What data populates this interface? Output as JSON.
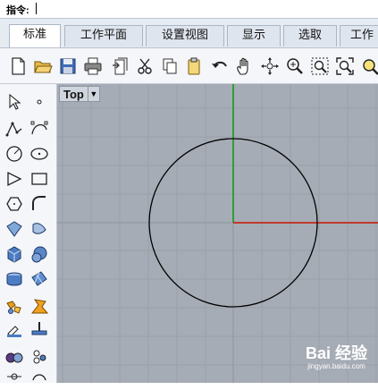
{
  "command": {
    "label": "指令:"
  },
  "tabs": [
    {
      "label": "标准",
      "active": true
    },
    {
      "label": "工作平面",
      "active": false
    },
    {
      "label": "设置视图",
      "active": false
    },
    {
      "label": "显示",
      "active": false
    },
    {
      "label": "选取",
      "active": false
    },
    {
      "label": "工作",
      "active": false
    }
  ],
  "toolbar_icons": [
    "new-file-icon",
    "open-folder-icon",
    "save-icon",
    "print-icon",
    "import-icon",
    "cut-icon",
    "copy-icon",
    "paste-icon",
    "undo-icon",
    "pan-hand-icon",
    "rotate-view-icon",
    "zoom-icon",
    "zoom-window-icon",
    "zoom-extents-icon",
    "zoom-selected-icon"
  ],
  "left_toolbar_icons": [
    "select-icon",
    "point-icon",
    "polyline-icon",
    "curve-icon",
    "circle-icon",
    "ellipse-icon",
    "arc-icon",
    "rectangle-icon",
    "polygon-icon",
    "fillet-curve-icon",
    "surface-icon",
    "surface-edit-icon",
    "solid-box-icon",
    "solid-sphere-icon",
    "extrude-icon",
    "mesh-icon",
    "explode-icon",
    "boolean-icon",
    "transform-icon",
    "analyze-icon",
    "render-icon",
    "group-icon",
    "dimension-icon",
    "arc-misc-icon"
  ],
  "viewport": {
    "name": "Top",
    "background": "#a6acb5",
    "grid_color": "#9aa0a9",
    "x_axis_color": "#c0392b",
    "y_axis_color": "#2e9d3a",
    "circle_color": "#000000"
  },
  "watermark": {
    "main": "Bai 经验",
    "sub": "jingyan.baidu.com"
  }
}
